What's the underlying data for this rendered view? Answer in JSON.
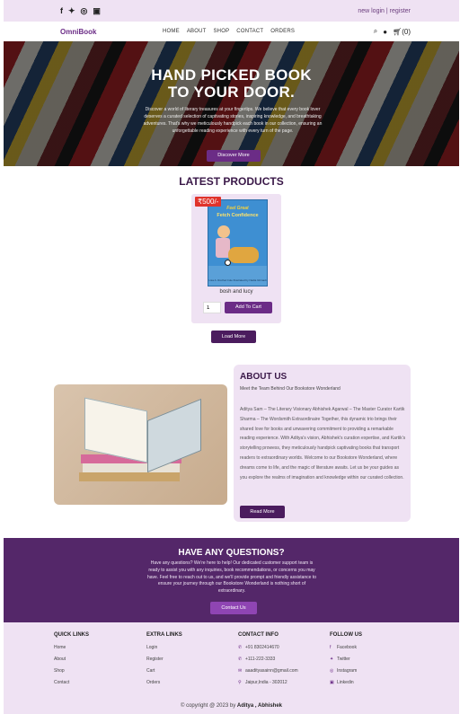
{
  "topbar": {
    "social_icons": [
      "facebook-icon",
      "twitter-icon",
      "instagram-icon",
      "linkedin-icon"
    ],
    "login": "new login",
    "register": "register"
  },
  "nav": {
    "brand": "OmniBook",
    "menu": [
      "HOME",
      "ABOUT",
      "SHOP",
      "CONTACT",
      "ORDERS"
    ],
    "cart_count": "(0)"
  },
  "hero": {
    "title_line1": "HAND PICKED BOOK",
    "title_line2": "TO YOUR DOOR.",
    "text": "Discover a world of literary treasures at your fingertips. We believe that every book lover deserves a curated selection of captivating stories, inspiring knowledge, and breathtaking adventures. That's why we meticulously handpick each book in our collection, ensuring an unforgettable reading experience with every turn of the page.",
    "button": "Discover More"
  },
  "latest": {
    "title": "LATEST PRODUCTS",
    "products": [
      {
        "price": "₹500/-",
        "cover_title1": "Feel Great",
        "cover_title2": "Fetch Confidence",
        "cover_author": "Lisa A. Rochat Cole\nIllustrated by Nadia Ghinadi",
        "name": "bosh and lucy",
        "qty": "1",
        "add_button": "Add To Cart"
      }
    ],
    "load_more": "Load More"
  },
  "about": {
    "title": "ABOUT US",
    "subtitle": "Meet the Team Behind Our Bookstore Wonderland",
    "text": "Aditya Sam – The Literary Visionary Abhishek Agarwal – The Master Curator Kartik Sharma – The Wordsmith Extraordinaire Together, this dynamic trio brings their shared love for books and unwavering commitment to providing a remarkable reading experience. With Aditya's vision, Abhishek's curation expertise, and Kartik's storytelling prowess, they meticulously handpick captivating books that transport readers to extraordinary worlds. Welcome to our Bookstore Wonderland, where dreams come to life, and the magic of literature awaits. Let us be your guides as you explore the realms of imagination and knowledge within our curated collection.",
    "button": "Read More"
  },
  "questions": {
    "title": "HAVE ANY QUESTIONS?",
    "text": "Have any questions? We're here to help! Our dedicated customer support team is ready to assist you with any inquiries, book recommendations, or concerns you may have. Feel free to reach out to us, and we'll provide prompt and friendly assistance to ensure your journey through our Bookstore Wonderland is nothing short of extraordinary.",
    "button": "Contact Us"
  },
  "footer": {
    "quick_links": {
      "title": "QUICK LINKS",
      "items": [
        "Home",
        "About",
        "Shop",
        "Contact"
      ]
    },
    "extra_links": {
      "title": "EXTRA LINKS",
      "items": [
        "Login",
        "Register",
        "Cart",
        "Orders"
      ]
    },
    "contact_info": {
      "title": "CONTACT INFO",
      "items": [
        "+91 8302414670",
        "+111-222-3333",
        "aaadityasainn@gmail.com",
        "Jaipur,India - 302012"
      ]
    },
    "follow_us": {
      "title": "FOLLOW US",
      "items": [
        "Facebook",
        "Twitter",
        "Instagram",
        "Linkedin"
      ]
    },
    "copyright_prefix": "© copyright @ 2023 by ",
    "copyright_names": "Aditya , Abhishek"
  }
}
